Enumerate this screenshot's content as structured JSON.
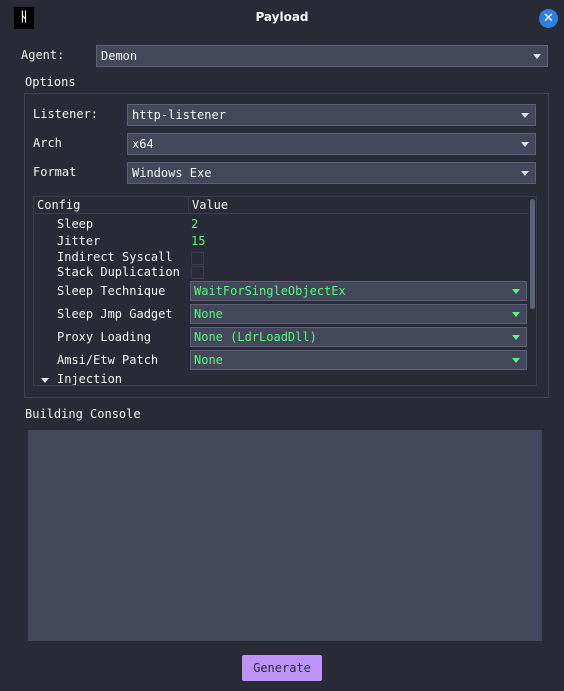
{
  "window": {
    "title": "Payload",
    "icon_glyph": "ᚺ",
    "close_glyph": "✕"
  },
  "agent": {
    "label": "Agent:",
    "value": "Demon"
  },
  "options": {
    "title": "Options",
    "listener": {
      "label": "Listener:",
      "value": "http-listener"
    },
    "arch": {
      "label": "Arch",
      "value": "x64"
    },
    "format": {
      "label": "Format",
      "value": "Windows Exe"
    }
  },
  "config_table": {
    "headers": [
      "Config",
      "Value"
    ],
    "rows": {
      "sleep": {
        "key": "Sleep",
        "value": "2"
      },
      "jitter": {
        "key": "Jitter",
        "value": "15"
      },
      "indirect_syscall": {
        "key": "Indirect Syscall",
        "checked": false
      },
      "stack_duplication": {
        "key": "Stack Duplication",
        "checked": false
      },
      "sleep_technique": {
        "key": "Sleep Technique",
        "value": "WaitForSingleObjectEx"
      },
      "sleep_jmp_gadget": {
        "key": "Sleep Jmp Gadget",
        "value": "None"
      },
      "proxy_loading": {
        "key": "Proxy Loading",
        "value": "None (LdrLoadDll)"
      },
      "amsi_etw_patch": {
        "key": "Amsi/Etw Patch",
        "value": "None"
      },
      "injection": {
        "key": "Injection"
      }
    }
  },
  "console": {
    "title": "Building Console",
    "content": ""
  },
  "generate_button": {
    "label": "Generate"
  },
  "colors": {
    "background": "#282a36",
    "field": "#44475a",
    "value_green": "#50fa7b",
    "button_purple": "#bd93f9",
    "close_blue": "#2f7fe0"
  }
}
